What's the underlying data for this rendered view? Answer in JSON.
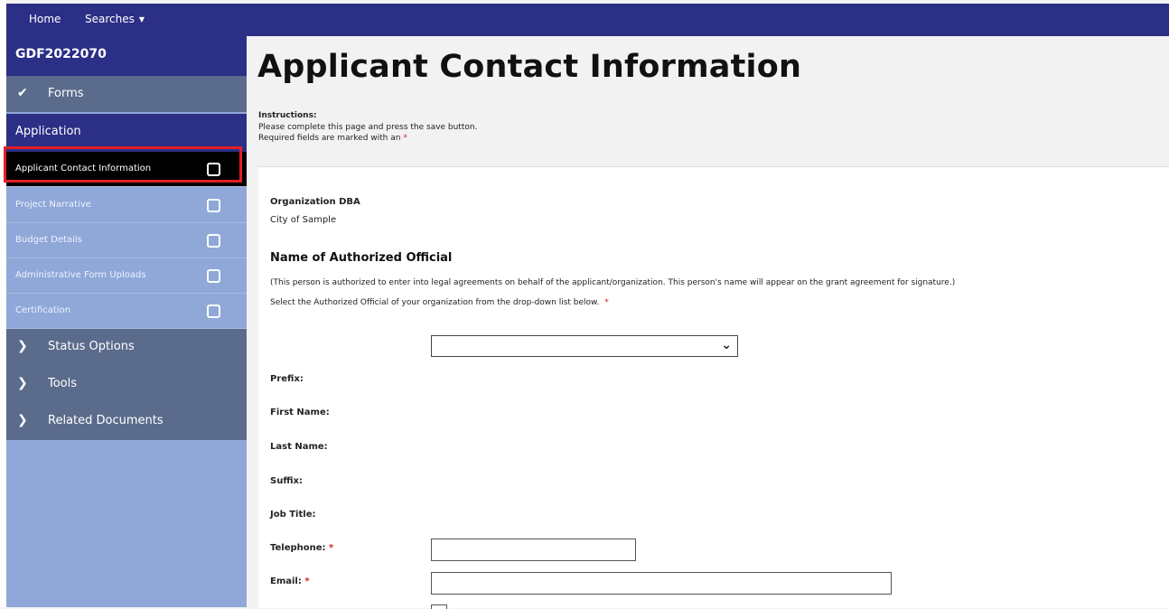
{
  "topnav": {
    "home": "Home",
    "searches": "Searches"
  },
  "sidebar": {
    "case_id": "GDF2022070",
    "forms_label": "Forms",
    "application_label": "Application",
    "items": [
      {
        "label": "Applicant Contact Information",
        "active": true
      },
      {
        "label": "Project Narrative"
      },
      {
        "label": "Budget Details"
      },
      {
        "label": "Administrative Form Uploads"
      },
      {
        "label": "Certification"
      }
    ],
    "sections": [
      "Status Options",
      "Tools",
      "Related Documents"
    ]
  },
  "page": {
    "title": "Applicant Contact Information",
    "instructions_label": "Instructions:",
    "instructions_line1": "Please complete this page and press the save button.",
    "instructions_line2": "Required fields are marked with an",
    "required_marker": "*"
  },
  "form": {
    "org_dba_label": "Organization DBA",
    "org_dba_value": "City of Sample",
    "authorized_heading": "Name of Authorized Official",
    "authorized_note": "(This person is authorized to enter into legal agreements on behalf of the applicant/organization. This person's name will appear on the grant agreement for signature.)",
    "select_prompt": "Select the Authorized Official of your organization from the drop-down list below.",
    "official_select_value": "",
    "prefix_label": "Prefix:",
    "first_name_label": "First Name:",
    "last_name_label": "Last Name:",
    "suffix_label": "Suffix:",
    "job_title_label": "Job Title:",
    "telephone_label": "Telephone:",
    "telephone_value": "",
    "email_label": "Email:",
    "email_value": ""
  },
  "colors": {
    "navy": "#2b2f86",
    "sidebar_light": "#8fa8d8",
    "sidebar_dark": "#5b6b8c",
    "highlight_red": "#e41e26",
    "required_red": "#d21e1e"
  }
}
